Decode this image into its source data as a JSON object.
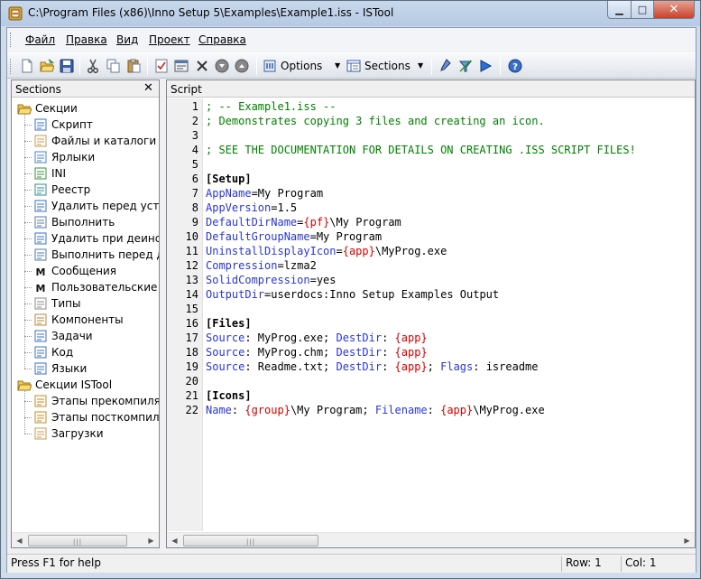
{
  "window": {
    "title": "C:\\Program Files (x86)\\Inno Setup 5\\Examples\\Example1.iss - ISTool",
    "minimize_glyph": "▁",
    "maximize_glyph": "□",
    "close_glyph": "✕"
  },
  "menu": {
    "items": [
      "Файл",
      "Правка",
      "Вид",
      "Проект",
      "Справка"
    ]
  },
  "toolbar": {
    "options_label": "Options",
    "sections_label": "Sections",
    "icons": [
      "new-file-icon",
      "open-folder-icon",
      "save-icon",
      "cut-icon",
      "copy-icon",
      "paste-icon",
      "checklist-icon",
      "form-icon",
      "delete-icon",
      "move-down-icon",
      "move-up-icon",
      "options-icon",
      "sections-icon",
      "compile-icon",
      "build-icon",
      "run-icon",
      "help-icon"
    ]
  },
  "sections_panel": {
    "title": "Sections",
    "close_glyph": "✕",
    "tree": [
      {
        "label": "Секции",
        "level": 0,
        "icon": "folder-open-icon"
      },
      {
        "label": "Скрипт",
        "level": 1,
        "icon": "script-icon"
      },
      {
        "label": "Файлы и каталоги",
        "level": 1,
        "icon": "files-icon"
      },
      {
        "label": "Ярлыки",
        "level": 1,
        "icon": "shortcut-icon"
      },
      {
        "label": "INI",
        "level": 1,
        "icon": "ini-icon"
      },
      {
        "label": "Реестр",
        "level": 1,
        "icon": "registry-icon"
      },
      {
        "label": "Удалить перед устано",
        "level": 1,
        "icon": "delete-install-icon"
      },
      {
        "label": "Выполнить",
        "level": 1,
        "icon": "run-program-icon"
      },
      {
        "label": "Удалить при деинстал",
        "level": 1,
        "icon": "delete-uninstall-icon"
      },
      {
        "label": "Выполнить перед деи",
        "level": 1,
        "icon": "run-uninstall-icon"
      },
      {
        "label": "Сообщения",
        "level": 1,
        "icon": "messages-icon"
      },
      {
        "label": "Пользовательские со",
        "level": 1,
        "icon": "custom-messages-icon"
      },
      {
        "label": "Типы",
        "level": 1,
        "icon": "types-icon"
      },
      {
        "label": "Компоненты",
        "level": 1,
        "icon": "components-icon"
      },
      {
        "label": "Задачи",
        "level": 1,
        "icon": "tasks-icon"
      },
      {
        "label": "Код",
        "level": 1,
        "icon": "code-icon"
      },
      {
        "label": "Языки",
        "level": 1,
        "icon": "languages-icon"
      },
      {
        "label": "Секции ISTool",
        "level": 0,
        "icon": "folder-open-icon"
      },
      {
        "label": "Этапы прекомпиляци",
        "level": 1,
        "icon": "precompile-icon"
      },
      {
        "label": "Этапы посткомпиляци",
        "level": 1,
        "icon": "postcompile-icon"
      },
      {
        "label": "Загрузки",
        "level": 1,
        "icon": "downloads-icon"
      }
    ]
  },
  "script_panel": {
    "title": "Script",
    "lines": [
      [
        {
          "t": "; -- Example1.iss --",
          "k": "comment"
        }
      ],
      [
        {
          "t": "; Demonstrates copying 3 files and creating an icon.",
          "k": "comment"
        }
      ],
      [],
      [
        {
          "t": "; SEE THE DOCUMENTATION FOR DETAILS ON CREATING .ISS SCRIPT FILES!",
          "k": "comment"
        }
      ],
      [],
      [
        {
          "t": "[Setup]",
          "k": "section"
        }
      ],
      [
        {
          "t": "AppName",
          "k": "key"
        },
        {
          "t": "=My Program",
          "k": "val"
        }
      ],
      [
        {
          "t": "AppVersion",
          "k": "key"
        },
        {
          "t": "=1.5",
          "k": "val"
        }
      ],
      [
        {
          "t": "DefaultDirName",
          "k": "key"
        },
        {
          "t": "=",
          "k": "val"
        },
        {
          "t": "{pf}",
          "k": "const"
        },
        {
          "t": "\\My Program",
          "k": "val"
        }
      ],
      [
        {
          "t": "DefaultGroupName",
          "k": "key"
        },
        {
          "t": "=My Program",
          "k": "val"
        }
      ],
      [
        {
          "t": "UninstallDisplayIcon",
          "k": "key"
        },
        {
          "t": "=",
          "k": "val"
        },
        {
          "t": "{app}",
          "k": "const"
        },
        {
          "t": "\\MyProg.exe",
          "k": "val"
        }
      ],
      [
        {
          "t": "Compression",
          "k": "key"
        },
        {
          "t": "=lzma2",
          "k": "val"
        }
      ],
      [
        {
          "t": "SolidCompression",
          "k": "key"
        },
        {
          "t": "=yes",
          "k": "val"
        }
      ],
      [
        {
          "t": "OutputDir",
          "k": "key"
        },
        {
          "t": "=userdocs:Inno Setup Examples Output",
          "k": "val"
        }
      ],
      [],
      [
        {
          "t": "[Files]",
          "k": "section"
        }
      ],
      [
        {
          "t": "Source",
          "k": "key"
        },
        {
          "t": ": MyProg.exe; ",
          "k": "val"
        },
        {
          "t": "DestDir",
          "k": "key"
        },
        {
          "t": ": ",
          "k": "val"
        },
        {
          "t": "{app}",
          "k": "const"
        }
      ],
      [
        {
          "t": "Source",
          "k": "key"
        },
        {
          "t": ": MyProg.chm; ",
          "k": "val"
        },
        {
          "t": "DestDir",
          "k": "key"
        },
        {
          "t": ": ",
          "k": "val"
        },
        {
          "t": "{app}",
          "k": "const"
        }
      ],
      [
        {
          "t": "Source",
          "k": "key"
        },
        {
          "t": ": Readme.txt; ",
          "k": "val"
        },
        {
          "t": "DestDir",
          "k": "key"
        },
        {
          "t": ": ",
          "k": "val"
        },
        {
          "t": "{app}",
          "k": "const"
        },
        {
          "t": "; ",
          "k": "val"
        },
        {
          "t": "Flags",
          "k": "key"
        },
        {
          "t": ": isreadme",
          "k": "val"
        }
      ],
      [],
      [
        {
          "t": "[Icons]",
          "k": "section"
        }
      ],
      [
        {
          "t": "Name",
          "k": "key"
        },
        {
          "t": ": ",
          "k": "val"
        },
        {
          "t": "{group}",
          "k": "const"
        },
        {
          "t": "\\My Program; ",
          "k": "val"
        },
        {
          "t": "Filename",
          "k": "key"
        },
        {
          "t": ": ",
          "k": "val"
        },
        {
          "t": "{app}",
          "k": "const"
        },
        {
          "t": "\\MyProg.exe",
          "k": "val"
        }
      ]
    ]
  },
  "scrollbar": {
    "left_arrow": "◀",
    "right_arrow": "▶",
    "grip": "|||"
  },
  "status": {
    "help": "Press F1 for help",
    "row": "Row: 1",
    "col": "Col: 1"
  },
  "colors": {
    "comment": "#008000",
    "key": "#2a36d6",
    "const": "#d40000"
  }
}
